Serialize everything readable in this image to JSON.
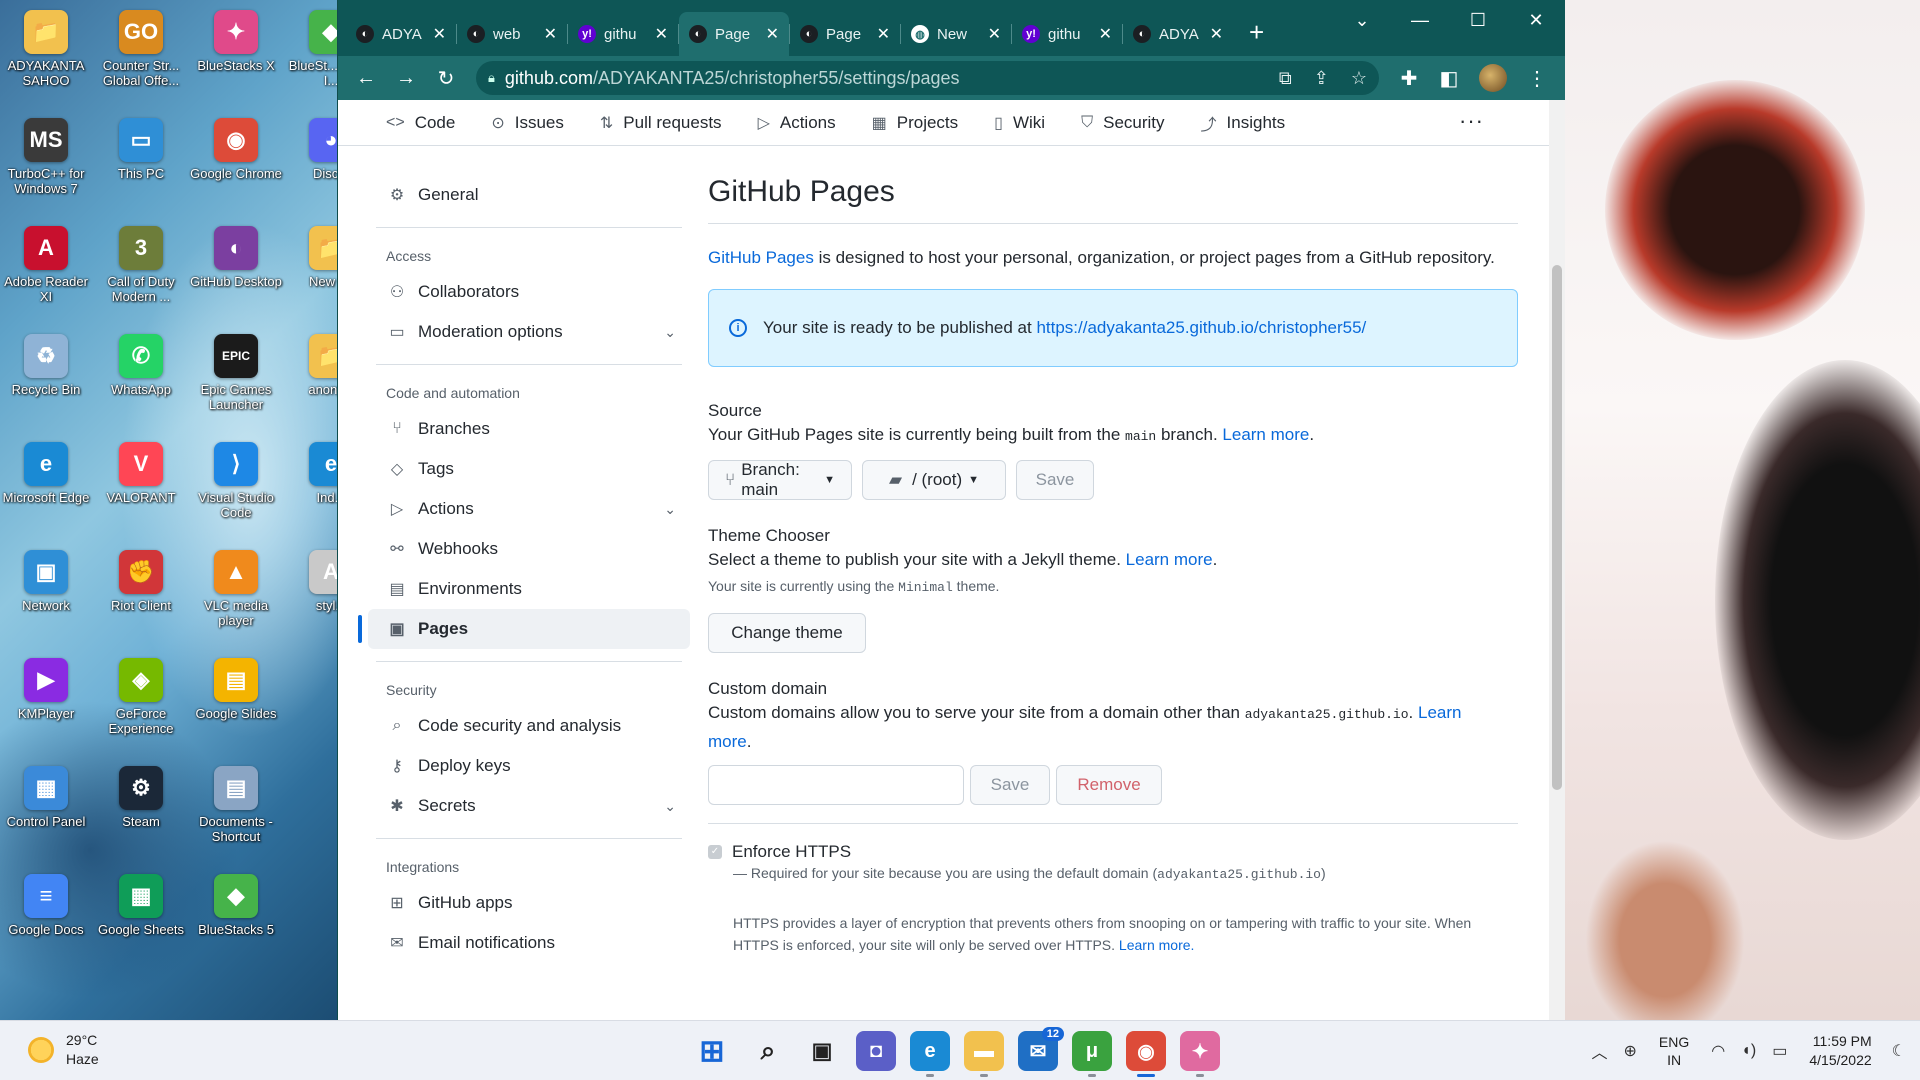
{
  "desktop": {
    "icons": [
      {
        "label": "ADYAKANTA SAHOO",
        "glyph": "📁",
        "color": "#f2c14e"
      },
      {
        "label": "Counter Str... Global Offe...",
        "glyph": "GO",
        "color": "#d98a1f"
      },
      {
        "label": "BlueStacks X",
        "glyph": "✦",
        "color": "#e04a8a"
      },
      {
        "label": "BlueSt... Multi-I...",
        "glyph": "◆",
        "color": "#46b34a"
      },
      {
        "label": "TurboC++ for Windows 7",
        "glyph": "MS",
        "color": "#3a3a3a"
      },
      {
        "label": "This PC",
        "glyph": "▭",
        "color": "#2f8fd6"
      },
      {
        "label": "Google Chrome",
        "glyph": "◉",
        "color": "#dd4b39"
      },
      {
        "label": "Disc...",
        "glyph": "◕",
        "color": "#5865f2"
      },
      {
        "label": "Adobe Reader XI",
        "glyph": "A",
        "color": "#c8102e"
      },
      {
        "label": "Call of Duty Modern ...",
        "glyph": "3",
        "color": "#6d7d3a"
      },
      {
        "label": "GitHub Desktop",
        "glyph": "◐",
        "color": "#7b3fa0"
      },
      {
        "label": "New f...",
        "glyph": "📁",
        "color": "#f2c14e"
      },
      {
        "label": "Recycle Bin",
        "glyph": "♻",
        "color": "#8fb3d6"
      },
      {
        "label": "WhatsApp",
        "glyph": "✆",
        "color": "#25d366"
      },
      {
        "label": "Epic Games Launcher",
        "glyph": "EPIC",
        "color": "#1b1b1b"
      },
      {
        "label": "anony...",
        "glyph": "📁",
        "color": "#f2c14e"
      },
      {
        "label": "Microsoft Edge",
        "glyph": "e",
        "color": "#1a8ad4"
      },
      {
        "label": "VALORANT",
        "glyph": "V",
        "color": "#ff4655"
      },
      {
        "label": "Visual Studio Code",
        "glyph": "⟩",
        "color": "#1e88e5"
      },
      {
        "label": "Ind...",
        "glyph": "e",
        "color": "#1a8ad4"
      },
      {
        "label": "Network",
        "glyph": "▣",
        "color": "#2f8fd6"
      },
      {
        "label": "Riot Client",
        "glyph": "✊",
        "color": "#d13639"
      },
      {
        "label": "VLC media player",
        "glyph": "▲",
        "color": "#f08a1c"
      },
      {
        "label": "styl...",
        "glyph": "A",
        "color": "#c9c9c9"
      },
      {
        "label": "KMPlayer",
        "glyph": "▶",
        "color": "#8a2be2"
      },
      {
        "label": "GeForce Experience",
        "glyph": "◈",
        "color": "#76b900"
      },
      {
        "label": "Google Slides",
        "glyph": "▤",
        "color": "#f4b400"
      },
      {
        "label": "",
        "glyph": "",
        "color": "transparent"
      },
      {
        "label": "Control Panel",
        "glyph": "▦",
        "color": "#3b8ad9"
      },
      {
        "label": "Steam",
        "glyph": "⚙",
        "color": "#1b2838"
      },
      {
        "label": "Documents - Shortcut",
        "glyph": "▤",
        "color": "#8aa5c4"
      },
      {
        "label": "",
        "glyph": "",
        "color": "transparent"
      },
      {
        "label": "Google Docs",
        "glyph": "≡",
        "color": "#4285f4"
      },
      {
        "label": "Google Sheets",
        "glyph": "▦",
        "color": "#0f9d58"
      },
      {
        "label": "BlueStacks 5",
        "glyph": "◆",
        "color": "#46b34a"
      }
    ]
  },
  "browser": {
    "tabs": [
      {
        "label": "ADYA",
        "favicon": "◐",
        "fav_color": "#1b1f23"
      },
      {
        "label": "web",
        "favicon": "◐",
        "fav_color": "#1b1f23"
      },
      {
        "label": "githu",
        "favicon": "y!",
        "fav_color": "#6001d2"
      },
      {
        "label": "Page",
        "favicon": "◐",
        "fav_color": "#1b1f23"
      },
      {
        "label": "Page",
        "favicon": "◐",
        "fav_color": "#1b1f23"
      },
      {
        "label": "New",
        "favicon": "◍",
        "fav_color": "#ffffff"
      },
      {
        "label": "githu",
        "favicon": "y!",
        "fav_color": "#6001d2"
      },
      {
        "label": "ADYA",
        "favicon": "◐",
        "fav_color": "#1b1f23"
      }
    ],
    "active_tab": 3,
    "url_host": "github.com",
    "url_path": "/ADYAKANTA25/christopher55/settings/pages"
  },
  "repo_nav": [
    {
      "label": "Code",
      "icon": "<>"
    },
    {
      "label": "Issues",
      "icon": "⊙"
    },
    {
      "label": "Pull requests",
      "icon": "⇅"
    },
    {
      "label": "Actions",
      "icon": "▷"
    },
    {
      "label": "Projects",
      "icon": "▦"
    },
    {
      "label": "Wiki",
      "icon": "▯"
    },
    {
      "label": "Security",
      "icon": "⛉"
    },
    {
      "label": "Insights",
      "icon": "⤴"
    }
  ],
  "sidebar": {
    "general": "General",
    "access_heading": "Access",
    "collaborators": "Collaborators",
    "moderation": "Moderation options",
    "code_heading": "Code and automation",
    "branches": "Branches",
    "tags": "Tags",
    "actions": "Actions",
    "webhooks": "Webhooks",
    "environments": "Environments",
    "pages": "Pages",
    "security_heading": "Security",
    "code_security": "Code security and analysis",
    "deploy_keys": "Deploy keys",
    "secrets": "Secrets",
    "integrations_heading": "Integrations",
    "github_apps": "GitHub apps",
    "email_notifications": "Email notifications"
  },
  "content": {
    "title": "GitHub Pages",
    "intro_link": "GitHub Pages",
    "intro_text": " is designed to host your personal, organization, or project pages from a GitHub repository.",
    "flash_text": "Your site is ready to be published at ",
    "flash_url": "https://adyakanta25.github.io/christopher55/",
    "source_title": "Source",
    "source_text_a": "Your GitHub Pages site is currently being built from the ",
    "source_branch_code": "main",
    "source_text_b": " branch. ",
    "learn_more": "Learn more",
    "branch_button": "Branch: main",
    "folder_button": "/ (root)",
    "save": "Save",
    "theme_title": "Theme Chooser",
    "theme_text": "Select a theme to publish your site with a Jekyll theme. ",
    "theme_current_a": "Your site is currently using the ",
    "theme_current_code": "Minimal",
    "theme_current_b": " theme.",
    "change_theme": "Change theme",
    "domain_title": "Custom domain",
    "domain_text_a": "Custom domains allow you to serve your site from a domain other than ",
    "domain_code": "adyakanta25.github.io",
    "domain_text_b": ". ",
    "learn": "Learn",
    "more": "more",
    "remove": "Remove",
    "https_title": "Enforce HTTPS",
    "https_required_a": "— Required for your site because you are using the default domain (",
    "https_required_code": "adyakanta25.github.io",
    "https_required_b": ")",
    "https_desc": "HTTPS provides a layer of encryption that prevents others from snooping on or tampering with traffic to your site. When HTTPS is enforced, your site will only be served over HTTPS. ",
    "https_learn_more": "Learn more."
  },
  "taskbar": {
    "temperature": "29°C",
    "weather": "Haze",
    "mail_badge": "12",
    "lang": "ENG",
    "region": "IN",
    "time": "11:59 PM",
    "date": "4/15/2022"
  }
}
